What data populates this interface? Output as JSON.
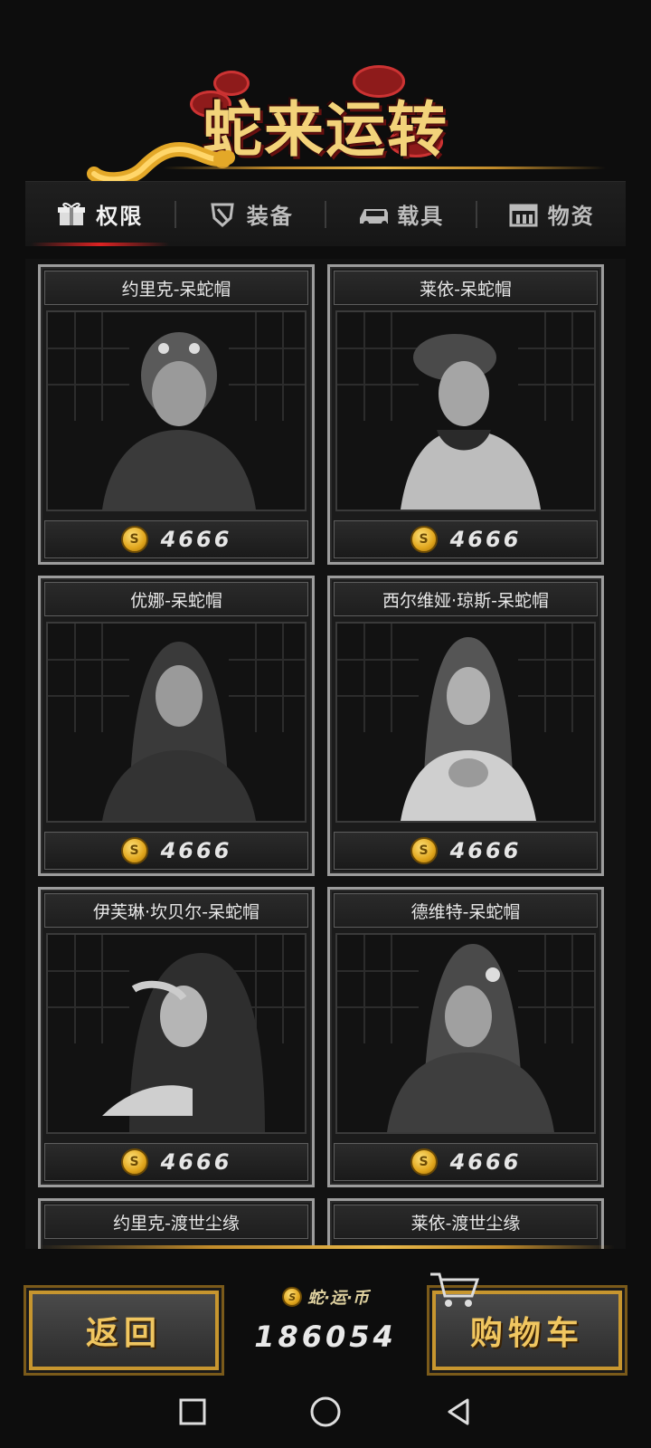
{
  "banner": {
    "title": "蛇来运转"
  },
  "tabs": [
    {
      "label": "权限",
      "icon": "gift-box-icon",
      "active": true
    },
    {
      "label": "装备",
      "icon": "shield-icon",
      "active": false
    },
    {
      "label": "载具",
      "icon": "car-icon",
      "active": false
    },
    {
      "label": "物资",
      "icon": "crate-icon",
      "active": false
    }
  ],
  "items": [
    {
      "name": "约里克-呆蛇帽",
      "price": "4666"
    },
    {
      "name": "莱依-呆蛇帽",
      "price": "4666"
    },
    {
      "name": "优娜-呆蛇帽",
      "price": "4666"
    },
    {
      "name": "西尔维娅·琼斯-呆蛇帽",
      "price": "4666"
    },
    {
      "name": "伊芙琳·坎贝尔-呆蛇帽",
      "price": "4666"
    },
    {
      "name": "德维特-呆蛇帽",
      "price": "4666"
    },
    {
      "name": "约里克-渡世尘缘",
      "price": ""
    },
    {
      "name": "莱依-渡世尘缘",
      "price": ""
    }
  ],
  "footer": {
    "back_label": "返回",
    "cart_label": "购物车",
    "currency_label": "蛇·运·币",
    "balance": "186054"
  },
  "colors": {
    "accent_gold": "#e8b84a",
    "active_tab_red": "#d22222",
    "coin_gold": "#e0a51c"
  }
}
